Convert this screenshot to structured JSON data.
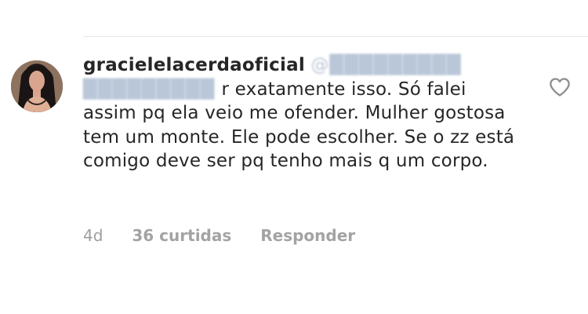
{
  "comment": {
    "username": "gracielelacerdaoficial",
    "mention_hidden": "@█████████",
    "line_fragment": "r exatamente isso. Só falei",
    "text_rest": "assim pq ela veio me ofender. Mulher gostosa tem um monte. Ele pode escolher. Se o zz está comigo deve ser pq tenho mais q um corpo.",
    "time": "4d",
    "likes": "36 curtidas",
    "reply_label": "Responder",
    "like_icon": "heart-outline-icon"
  },
  "colors": {
    "text": "#262626",
    "meta": "#a3a3a3",
    "divider": "#e6e6e6",
    "heart": "#8e8e8e"
  }
}
